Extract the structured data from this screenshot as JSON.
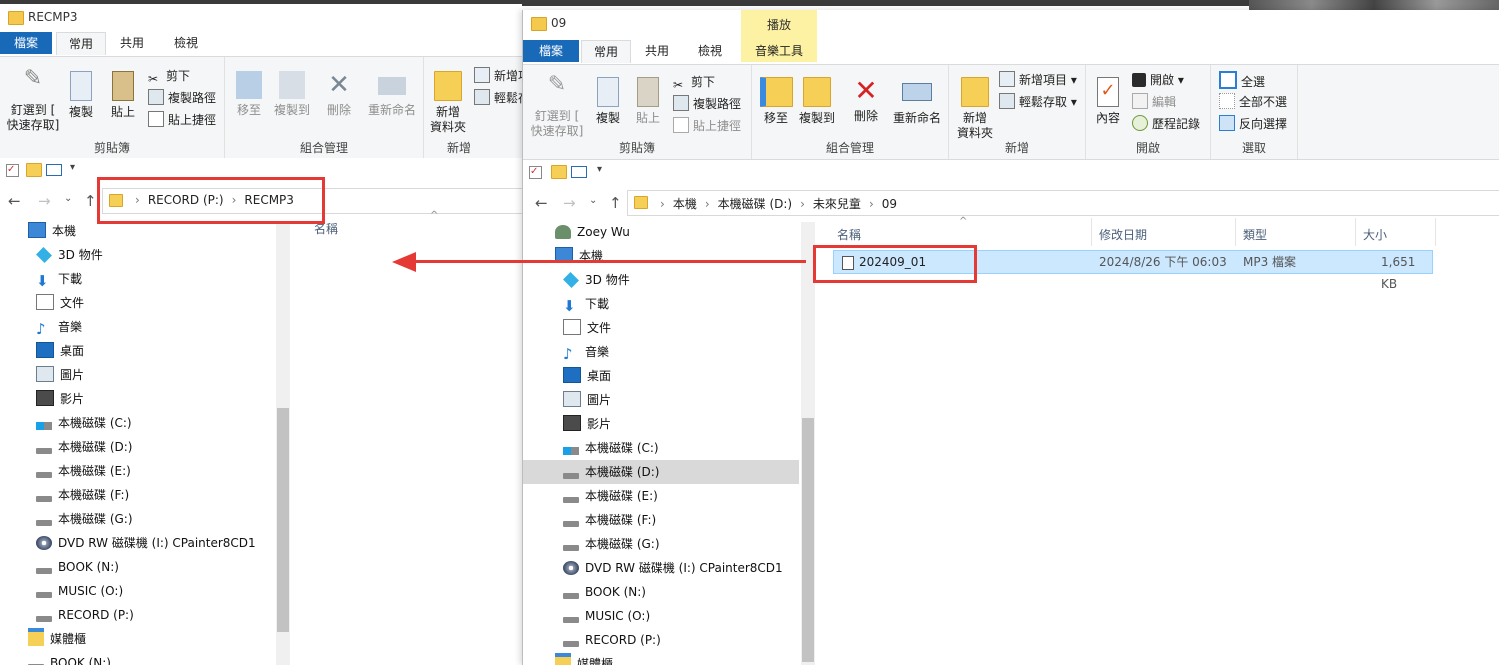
{
  "win1": {
    "title": "RECMP3",
    "tabs": [
      "檔案",
      "常用",
      "共用",
      "檢視"
    ],
    "ribbon": {
      "clipboard": {
        "pin": "釘選到 [",
        "pin2": "快速存取]",
        "copy": "複製",
        "paste": "貼上",
        "cut": "剪下",
        "copy_path": "複製路徑",
        "paste_shortcut": "貼上捷徑",
        "group": "剪貼簿"
      },
      "organize": {
        "move": "移至",
        "copyto": "複製到",
        "delete": "刪除",
        "rename": "重新命名",
        "group": "組合管理"
      },
      "new": {
        "new_folder": "新增",
        "new_folder2": "資料夾",
        "new_item": "新增項",
        "easy_access": "輕鬆存",
        "group": "新增"
      }
    },
    "breadcrumb": [
      "RECORD (P:)",
      "RECMP3"
    ],
    "column_name": "名稱",
    "tree": [
      "本機",
      "3D 物件",
      "下載",
      "文件",
      "音樂",
      "桌面",
      "圖片",
      "影片",
      "本機磁碟 (C:)",
      "本機磁碟 (D:)",
      "本機磁碟 (E:)",
      "本機磁碟 (F:)",
      "本機磁碟 (G:)",
      "DVD RW 磁碟機 (I:) CPainter8CD1",
      "BOOK (N:)",
      "MUSIC (O:)",
      "RECORD (P:)",
      "媒體櫃",
      "BOOK (N:)"
    ]
  },
  "win2": {
    "title": "09",
    "tabs": [
      "檔案",
      "常用",
      "共用",
      "檢視",
      "音樂工具"
    ],
    "context_tab": "播放",
    "ribbon": {
      "clipboard": {
        "pin": "釘選到 [",
        "pin2": "快速存取]",
        "copy": "複製",
        "paste": "貼上",
        "cut": "剪下",
        "copy_path": "複製路徑",
        "paste_shortcut": "貼上捷徑",
        "group": "剪貼簿"
      },
      "organize": {
        "move": "移至",
        "copyto": "複製到",
        "delete": "刪除",
        "rename": "重新命名",
        "group": "組合管理"
      },
      "new": {
        "new_folder": "新增",
        "new_folder2": "資料夾",
        "new_item": "新增項目",
        "easy_access": "輕鬆存取",
        "group": "新增"
      },
      "open": {
        "props": "內容",
        "open": "開啟",
        "edit": "編輯",
        "history": "歷程記錄",
        "group": "開啟"
      },
      "select": {
        "all": "全選",
        "none": "全部不選",
        "invert": "反向選擇",
        "group": "選取"
      }
    },
    "breadcrumb": [
      "本機",
      "本機磁碟 (D:)",
      "未來兒童",
      "09"
    ],
    "columns": [
      "名稱",
      "修改日期",
      "類型",
      "大小"
    ],
    "file": {
      "name": "202409_01",
      "date": "2024/8/26 下午 06:03",
      "type": "MP3 檔案",
      "size": "1,651 KB"
    },
    "tree": [
      "Zoey Wu",
      "本機",
      "3D 物件",
      "下載",
      "文件",
      "音樂",
      "桌面",
      "圖片",
      "影片",
      "本機磁碟 (C:)",
      "本機磁碟 (D:)",
      "本機磁碟 (E:)",
      "本機磁碟 (F:)",
      "本機磁碟 (G:)",
      "DVD RW 磁碟機 (I:) CPainter8CD1",
      "BOOK (N:)",
      "MUSIC (O:)",
      "RECORD (P:)",
      "媒體櫃"
    ]
  },
  "colors": {
    "accent": "#1969b9",
    "highlight": "#e53935",
    "selection": "#cce8ff",
    "context_tab": "#fdf2a4"
  }
}
